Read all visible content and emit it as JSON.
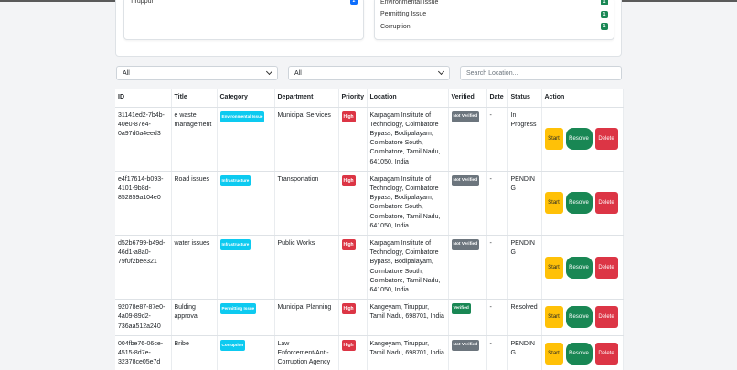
{
  "stats": {
    "left_items": [
      {
        "label": "Tiruppur",
        "count": "2",
        "color": "#0d6efd"
      }
    ],
    "right_items": [
      {
        "label": "Environmental Issue",
        "count": "1",
        "color": "#198754"
      },
      {
        "label": "Permitting Issue",
        "count": "1",
        "color": "#198754"
      },
      {
        "label": "Corruption",
        "count": "1",
        "color": "#198754"
      }
    ]
  },
  "filters": {
    "filter1_value": "All",
    "filter2_value": "All",
    "search_placeholder": "Search Location..."
  },
  "table": {
    "headers": {
      "id": "ID",
      "title": "Title",
      "category": "Category",
      "department": "Department",
      "priority": "Priority",
      "location": "Location",
      "verified": "Verified",
      "date": "Date",
      "status": "Status",
      "action": "Action"
    },
    "actions": {
      "start": "Start",
      "resolve": "Resolve",
      "delete": "Delete"
    },
    "rows": [
      {
        "id": "31141ed2-7b4b-40e0-87e4-0a97d0a4eed3",
        "title": "e waste management",
        "category": "Environmental Issue",
        "department": "Municipal Services",
        "priority": "High",
        "location": "Karpagam Institute of Technology, Coimbatore Bypass, Bodipalayam, Coimbatore South, Coimbatore, Tamil Nadu, 641050, India",
        "verified": "Not Verified",
        "verified_ok": false,
        "date": "-",
        "status": "In Progress"
      },
      {
        "id": "e4f17614-b093-4101-9b8d-852859a104e0",
        "title": "Road issues",
        "category": "Infrastructure",
        "department": "Transportation",
        "priority": "High",
        "location": "Karpagam Institute of Technology, Coimbatore Bypass, Bodipalayam, Coimbatore South, Coimbatore, Tamil Nadu, 641050, India",
        "verified": "Not Verified",
        "verified_ok": false,
        "date": "-",
        "status": "PENDING"
      },
      {
        "id": "d52b6799-b49d-46d1-a8a0-79f0f2bee321",
        "title": "water issues",
        "category": "Infrastructure",
        "department": "Public Works",
        "priority": "High",
        "location": "Karpagam Institute of Technology, Coimbatore Bypass, Bodipalayam, Coimbatore South, Coimbatore, Tamil Nadu, 641050, India",
        "verified": "Not Verified",
        "verified_ok": false,
        "date": "-",
        "status": "PENDING"
      },
      {
        "id": "92078e87-87e0-4a09-89d2-736aa512a240",
        "title": "Bulding approval",
        "category": "Permitting Issue",
        "department": "Municipal Planning",
        "priority": "High",
        "location": "Kangeyam, Tiruppur, Tamil Nadu, 698701, India",
        "verified": "Verified",
        "verified_ok": true,
        "date": "-",
        "status": "Resolved"
      },
      {
        "id": "004fbe76-06ce-4515-8d7e-32378ce05e7d",
        "title": "Bribe",
        "category": "Corruption",
        "department": "Law Enforcement/Anti-Corruption Agency",
        "priority": "High",
        "location": "Kangeyam, Tiruppur, Tamil Nadu, 698701, India",
        "verified": "Not Verified",
        "verified_ok": false,
        "date": "-",
        "status": "PENDING"
      }
    ]
  }
}
